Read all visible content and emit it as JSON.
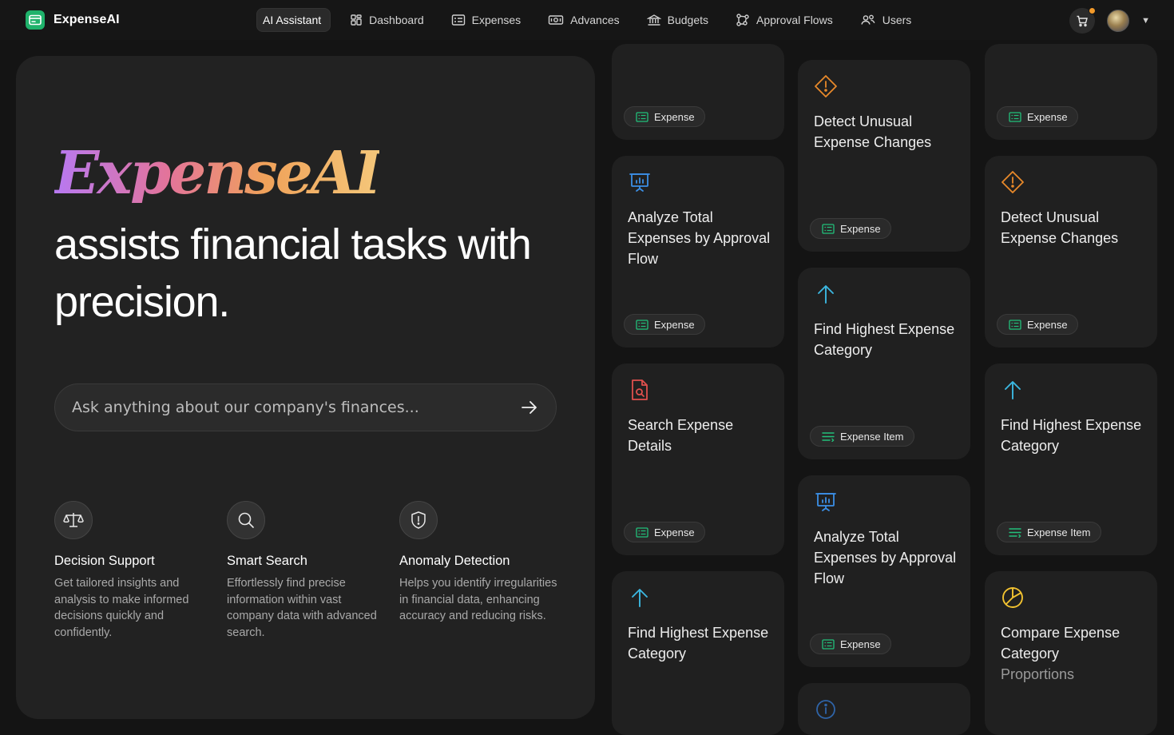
{
  "app": {
    "name": "ExpenseAI"
  },
  "nav": {
    "items": [
      {
        "label": "AI Assistant",
        "icon": "none",
        "active": true
      },
      {
        "label": "Dashboard",
        "icon": "grid-icon"
      },
      {
        "label": "Expenses",
        "icon": "receipt-list-icon"
      },
      {
        "label": "Advances",
        "icon": "banknote-icon"
      },
      {
        "label": "Budgets",
        "icon": "bank-icon"
      },
      {
        "label": "Approval Flows",
        "icon": "flow-icon"
      },
      {
        "label": "Users",
        "icon": "users-icon"
      }
    ]
  },
  "hero": {
    "logo_text": "ExpenseAI",
    "headline": "assists financial tasks with precision.",
    "ask_placeholder": "Ask anything about our company's finances...",
    "features": [
      {
        "title": "Decision Support",
        "desc": "Get tailored insights and analysis to make informed decisions quickly and confidently.",
        "icon": "scale-icon"
      },
      {
        "title": "Smart Search",
        "desc": "Effortlessly find precise information within vast company data with advanced search.",
        "icon": "search-icon"
      },
      {
        "title": "Anomaly Detection",
        "desc": "Helps you identify irregularities in financial data, enhancing accuracy and reducing risks.",
        "icon": "shield-alert-icon"
      }
    ]
  },
  "cards": {
    "col1": [
      {
        "title": "",
        "tag": "Expense"
      },
      {
        "title": "Analyze Total Expenses by Approval Flow",
        "tag": "Expense",
        "icon": "presentation-chart-icon"
      },
      {
        "title": "Search Expense Details",
        "tag": "Expense",
        "icon": "file-search-icon"
      },
      {
        "title": "Find Highest Expense Category",
        "tag": "",
        "icon": "arrow-up-icon"
      }
    ],
    "col2": [
      {
        "title": "Detect Unusual Expense Changes",
        "tag": "Expense",
        "icon": "warning-diamond-icon"
      },
      {
        "title": "Find Highest Expense Category",
        "tag": "Expense Item",
        "icon": "arrow-up-icon"
      },
      {
        "title": "Analyze Total Expenses by Approval Flow",
        "tag": "Expense",
        "icon": "presentation-chart-icon"
      },
      {
        "title": "",
        "tag": "",
        "icon": "info-icon"
      }
    ],
    "col3": [
      {
        "title": "",
        "tag": "Expense"
      },
      {
        "title": "Detect Unusual Expense Changes",
        "tag": "Expense",
        "icon": "warning-diamond-icon"
      },
      {
        "title": "Find Highest Expense Category",
        "tag": "Expense Item",
        "icon": "arrow-up-icon"
      },
      {
        "title_main": "Compare Expense Category",
        "title_muted": "Proportions",
        "icon": "pie-chart-icon"
      }
    ]
  },
  "colors": {
    "accent_green": "#1fb26b",
    "warning_orange": "#e8892a",
    "chart_blue": "#3b8fe6",
    "arrow_cyan": "#3bb7e0",
    "file_red": "#e0504d",
    "pie_yellow": "#f2c230",
    "notification_dot": "#f39a2a"
  }
}
